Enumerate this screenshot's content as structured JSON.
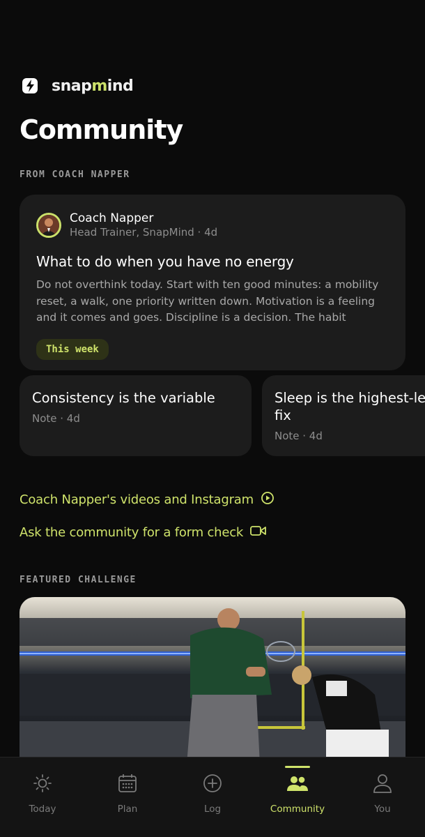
{
  "brand": {
    "name_part1": "snap",
    "name_part2": "m",
    "name_part3": "ind",
    "accent_color": "#cbe06a",
    "logo_icon": "lightning-bolt-icon"
  },
  "page_title": "Community",
  "coach_section": {
    "label": "FROM COACH NAPPER",
    "post": {
      "author": "Coach Napper",
      "meta": "Head Trainer, SnapMind · 4d",
      "title": "What to do when you have no energy",
      "body": "Do not overthink today. Start with ten good minutes: a mobility reset, a walk, one priority written down. Motivation is a feeling and it comes and goes. Discipline is a decision. The habit matters mo…",
      "tag": "This week"
    },
    "notes": [
      {
        "title": "Consistency is the variable",
        "meta": "Note · 4d"
      },
      {
        "title": "Sleep is the highest-lev fix",
        "meta": "Note · 4d"
      }
    ]
  },
  "links": [
    {
      "label": "Coach Napper's videos and Instagram",
      "icon": "play-circle-icon"
    },
    {
      "label": "Ask the community for a form check",
      "icon": "video-camera-icon"
    }
  ],
  "featured": {
    "label": "FEATURED CHALLENGE"
  },
  "nav": {
    "items": [
      {
        "label": "Today",
        "icon": "sun-icon",
        "active": false
      },
      {
        "label": "Plan",
        "icon": "calendar-icon",
        "active": false
      },
      {
        "label": "Log",
        "icon": "plus-circle-icon",
        "active": false
      },
      {
        "label": "Community",
        "icon": "people-icon",
        "active": true
      },
      {
        "label": "You",
        "icon": "person-icon",
        "active": false
      }
    ]
  }
}
